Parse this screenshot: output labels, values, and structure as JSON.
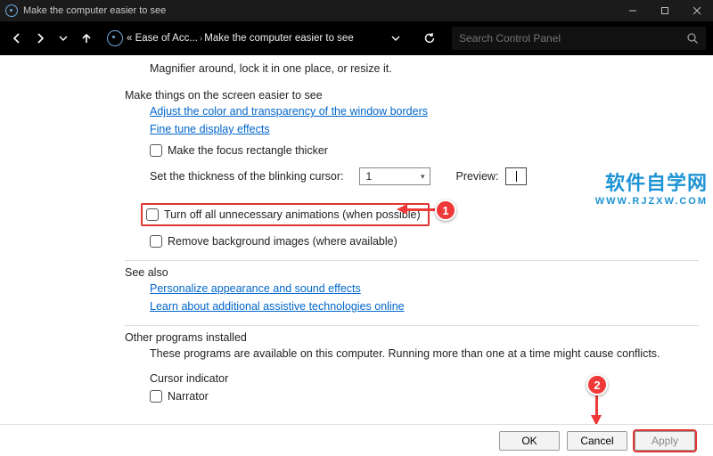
{
  "window": {
    "title": "Make the computer easier to see"
  },
  "nav": {
    "crumb1": "« Ease of Acc...",
    "crumb2": "Make the computer easier to see",
    "search_placeholder": "Search Control Panel"
  },
  "body": {
    "magnifier_tail": "Magnifier around, lock it in one place, or resize it.",
    "sec1_heading": "Make things on the screen easier to see",
    "link_adjust": "Adjust the color and transparency of the window borders",
    "link_finetune": "Fine tune display effects",
    "chk_focus": "Make the focus rectangle thicker",
    "cursor_label": "Set the thickness of the blinking cursor:",
    "cursor_value": "1",
    "preview_label": "Preview:",
    "chk_anim": "Turn off all unnecessary animations (when possible)",
    "chk_bg": "Remove background images (where available)",
    "sec2_heading": "See also",
    "link_personalize": "Personalize appearance and sound effects",
    "link_assistive": "Learn about additional assistive technologies online",
    "sec3_heading": "Other programs installed",
    "sec3_desc": "These programs are available on this computer. Running more than one at a time might cause conflicts.",
    "cursor_indicator": "Cursor indicator",
    "chk_narrator": "Narrator"
  },
  "buttons": {
    "ok": "OK",
    "cancel": "Cancel",
    "apply": "Apply"
  },
  "annot": {
    "b1": "1",
    "b2": "2"
  },
  "watermark": {
    "l1": "软件自学网",
    "l2": "WWW.RJZXW.COM"
  }
}
